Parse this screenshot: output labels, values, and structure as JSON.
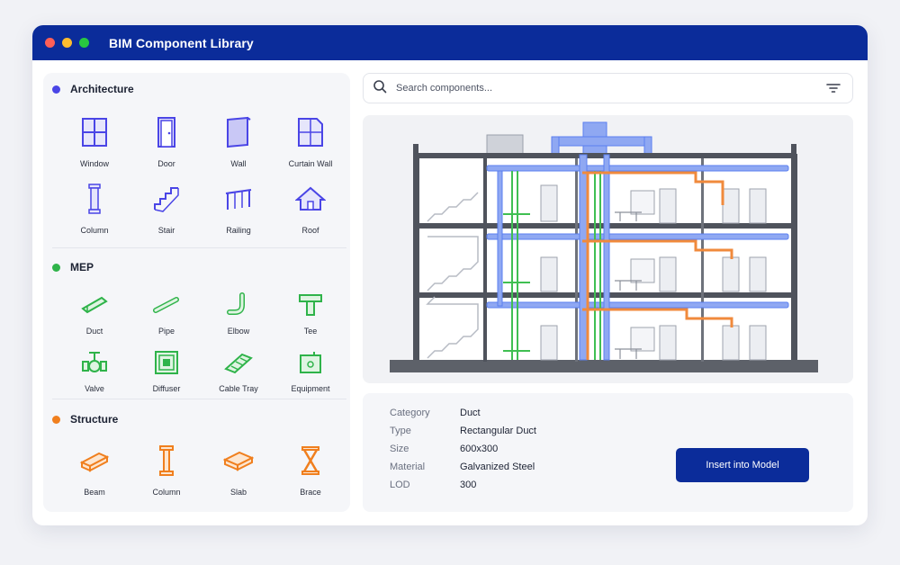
{
  "app": {
    "title": "BIM Component Library"
  },
  "window_controls": [
    "close",
    "minimize",
    "maximize"
  ],
  "sidebar": {
    "sections": [
      {
        "title": "Architecture",
        "color": "#4a45e6",
        "items": [
          {
            "label": "Window",
            "icon": "window-icon"
          },
          {
            "label": "Door",
            "icon": "door-icon"
          },
          {
            "label": "Wall",
            "icon": "wall-icon"
          },
          {
            "label": "Curtain Wall",
            "icon": "curtain-wall-icon"
          },
          {
            "label": "Column",
            "icon": "column-icon"
          },
          {
            "label": "Stair",
            "icon": "stair-icon"
          },
          {
            "label": "Railing",
            "icon": "railing-icon"
          },
          {
            "label": "Roof",
            "icon": "roof-icon"
          }
        ]
      },
      {
        "title": "MEP",
        "color": "#2fb34a",
        "items": [
          {
            "label": "Duct",
            "icon": "duct-icon"
          },
          {
            "label": "Pipe",
            "icon": "pipe-icon"
          },
          {
            "label": "Elbow",
            "icon": "elbow-icon"
          },
          {
            "label": "Tee",
            "icon": "tee-icon"
          },
          {
            "label": "Valve",
            "icon": "valve-icon"
          },
          {
            "label": "Diffuser",
            "icon": "diffuser-icon"
          },
          {
            "label": "Cable Tray",
            "icon": "cable-tray-icon"
          },
          {
            "label": "Equipment",
            "icon": "equipment-icon"
          }
        ]
      },
      {
        "title": "Structure",
        "color": "#f07f1e",
        "items": [
          {
            "label": "Beam",
            "icon": "beam-icon"
          },
          {
            "label": "Column",
            "icon": "structural-column-icon"
          },
          {
            "label": "Slab",
            "icon": "slab-icon"
          },
          {
            "label": "Brace",
            "icon": "brace-icon"
          }
        ]
      }
    ]
  },
  "search": {
    "placeholder": "Search components..."
  },
  "details": {
    "rows": [
      {
        "key": "Category",
        "value": "Duct"
      },
      {
        "key": "Type",
        "value": "Rectangular Duct"
      },
      {
        "key": "Size",
        "value": "600x300"
      },
      {
        "key": "Material",
        "value": "Galvanized Steel"
      },
      {
        "key": "LOD",
        "value": "300"
      }
    ],
    "insert_label": "Insert into Model"
  },
  "colors": {
    "accent": "#0b2c9a",
    "duct": "#5b7ff0",
    "pipe_green": "#3fbf52",
    "pipe_orange": "#f08a3c"
  }
}
